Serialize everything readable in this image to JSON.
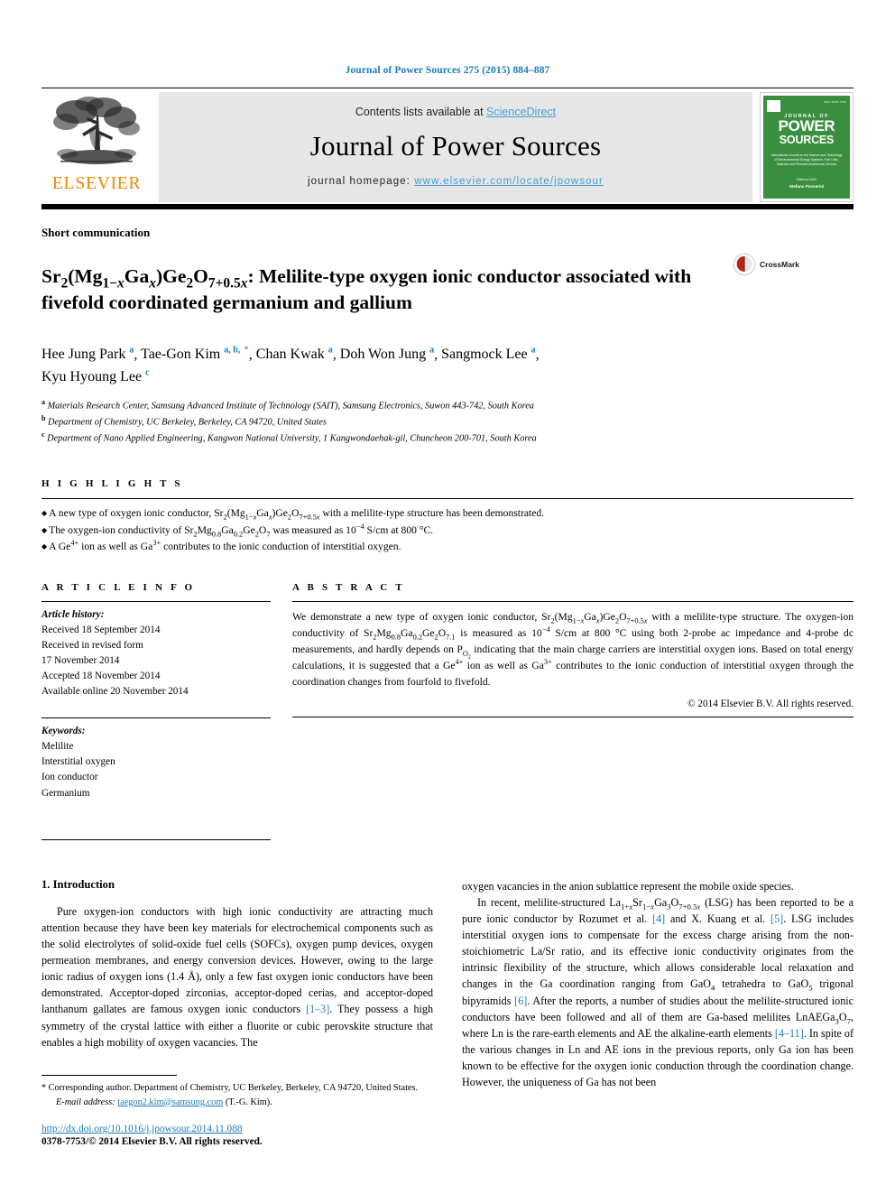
{
  "running_head": "Journal of Power Sources 275 (2015) 884–887",
  "masthead": {
    "publisher_name": "ELSEVIER",
    "publisher_logo_icon": "elsevier-tree-icon",
    "contents_prefix": "Contents lists available at ",
    "contents_link": "ScienceDirect",
    "journal_name": "Journal of Power Sources",
    "homepage_prefix": "journal homepage: ",
    "homepage_url": "www.elsevier.com/locate/jpowsour",
    "cover": {
      "journal_of": "JOURNAL OF",
      "word_power": "POWER",
      "word_sources": "SOURCES",
      "subtitle": "International Journal on the Science and Technology of Electrochemical Energy Systems: Fuel Cells, Batteries and Photoelectrochemical Devices",
      "footer_small": "Editor-in-Chief",
      "footer_name": "Stefano Passerini"
    }
  },
  "article": {
    "type": "Short communication",
    "title_line1_html": "Sr<sub>2</sub>(Mg<sub>1−<i>x</i></sub>Ga<sub><i>x</i></sub>)Ge<sub>2</sub>O<sub>7+0.5<i>x</i></sub>: Melilite-type oxygen ionic conductor",
    "title_line2": "associated with fivefold coordinated germanium and gallium",
    "crossmark_label": "CrossMark",
    "crossmark_icon": "crossmark-book-icon",
    "authors": [
      {
        "name": "Hee Jung Park",
        "marks": "a",
        "corresponding": false
      },
      {
        "name": "Tae-Gon Kim",
        "marks": "a, b,",
        "corresponding": true
      },
      {
        "name": "Chan Kwak",
        "marks": "a",
        "corresponding": false
      },
      {
        "name": "Doh Won Jung",
        "marks": "a",
        "corresponding": false
      },
      {
        "name": "Sangmock Lee",
        "marks": "a",
        "corresponding": false
      },
      {
        "name": "Kyu Hyoung Lee",
        "marks": "c",
        "corresponding": false
      }
    ],
    "affiliations": [
      {
        "mark": "a",
        "text": "Materials Research Center, Samsung Advanced Institute of Technology (SAIT), Samsung Electronics, Suwon 443-742, South Korea"
      },
      {
        "mark": "b",
        "text": "Department of Chemistry, UC Berkeley, Berkeley, CA 94720, United States"
      },
      {
        "mark": "c",
        "text": "Department of Nano Applied Engineering, Kangwon National University, 1 Kangwondaehak-gil, Chuncheon 200-701, South Korea"
      }
    ]
  },
  "highlights": {
    "label": "H I G H L I G H T S",
    "items_html": [
      "A new type of oxygen ionic conductor, Sr<sub>2</sub>(Mg<sub>1−<i>x</i></sub>Ga<sub><i>x</i></sub>)Ge<sub>2</sub>O<sub>7+0.5<i>x</i></sub> with a melilite-type structure has been demonstrated.",
      "The oxygen-ion conductivity of Sr<sub>2</sub>Mg<sub>0.8</sub>Ga<sub>0.2</sub>Ge<sub>2</sub>O<sub>7</sub> was measured as 10<sup>−4</sup> S/cm at 800 °C.",
      "A Ge<sup>4+</sup> ion as well as Ga<sup>3+</sup> contributes to the ionic conduction of interstitial oxygen."
    ]
  },
  "article_info": {
    "label": "A R T I C L E  I N F O",
    "history_label": "Article history:",
    "history": [
      "Received 18 September 2014",
      "Received in revised form",
      "17 November 2014",
      "Accepted 18 November 2014",
      "Available online 20 November 2014"
    ],
    "keywords_label": "Keywords:",
    "keywords": [
      "Melilite",
      "Interstitial oxygen",
      "Ion conductor",
      "Germanium"
    ]
  },
  "abstract": {
    "label": "A B S T R A C T",
    "text_html": "We demonstrate a new type of oxygen ionic conductor, Sr<sub>2</sub>(Mg<sub>1−<i>x</i></sub>Ga<sub><i>x</i></sub>)Ge<sub>2</sub>O<sub>7+0.5<i>x</i></sub> with a melilite-type structure. The oxygen-ion conductivity of Sr<sub>2</sub>Mg<sub>0.8</sub>Ga<sub>0.2</sub>Ge<sub>2</sub>O<sub>7.1</sub> is measured as 10<sup>−4</sup> S/cm at 800 °C using both 2-probe ac impedance and 4-probe dc measurements, and hardly depends on P<sub>O<sub>2</sub></sub> indicating that the main charge carriers are interstitial oxygen ions. Based on total energy calculations, it is suggested that a Ge<sup>4+</sup> ion as well as Ga<sup>3+</sup> contributes to the ionic conduction of interstitial oxygen through the coordination changes from fourfold to fivefold.",
    "copyright": "© 2014 Elsevier B.V. All rights reserved."
  },
  "body": {
    "section_heading": "1.  Introduction",
    "left_para_html": "Pure oxygen-ion conductors with high ionic conductivity are attracting much attention because they have been key materials for electrochemical components such as the solid electrolytes of solid-oxide fuel cells (SOFCs), oxygen pump devices, oxygen permeation membranes, and energy conversion devices. However, owing to the large ionic radius of oxygen ions (1.4 Å), only a few fast oxygen ionic conductors have been demonstrated. Acceptor-doped zirconias, acceptor-doped cerias, and acceptor-doped lanthanum gallates are famous oxygen ionic conductors <span class=\"ref\">[1–3]</span>. They possess a high symmetry of the crystal lattice with either a fluorite or cubic perovskite structure that enables a high mobility of oxygen vacancies. The",
    "right_para1_html": "oxygen vacancies in the anion sublattice represent the mobile oxide species.",
    "right_para2_html": "In recent, melilite-structured La<sub>1+<i>x</i></sub>Sr<sub>1−<i>x</i></sub>Ga<sub>3</sub>O<sub>7+0.5<i>x</i></sub> (LSG) has been reported to be a pure ionic conductor by Rozumet et al. <span class=\"ref\">[4]</span> and X. Kuang et al. <span class=\"ref\">[5]</span>. LSG includes interstitial oxygen ions to compensate for the excess charge arising from the non-stoichiometric La/Sr ratio, and its effective ionic conductivity originates from the intrinsic flexibility of the structure, which allows considerable local relaxation and changes in the Ga coordination ranging from GaO<sub>4</sub> tetrahedra to GaO<sub>5</sub> trigonal bipyramids <span class=\"ref\">[6]</span>. After the reports, a number of studies about the melilite-structured ionic conductors have been followed and all of them are Ga-based melilites LnAEGa<sub>3</sub>O<sub>7</sub>, where Ln is the rare-earth elements and AE the alkaline-earth elements <span class=\"ref\">[4–11]</span>. In spite of the various changes in Ln and AE ions in the previous reports, only Ga ion has been known to be effective for the oxygen ionic conduction through the coordination change. However, the uniqueness of Ga has not been"
  },
  "footnote": {
    "corresponding_html": "<span class=\"fn-star\">*</span> Corresponding author. Department of Chemistry, UC Berkeley, Berkeley, CA 94720, United States.",
    "email_label": "E-mail address:",
    "email": "taegon2.kim@samsung.com",
    "email_owner": "(T.-G. Kim).",
    "doi": "http://dx.doi.org/10.1016/j.jpowsour.2014.11.088",
    "issn_line": "0378-7753/© 2014 Elsevier B.V. All rights reserved."
  },
  "colors": {
    "link_blue": "#1a7bb9",
    "sciencedirect_blue": "#4a9fd4",
    "elsevier_orange": "#f08800",
    "cover_green": "#3a8f3f",
    "crossmark_red": "#b4261a"
  }
}
